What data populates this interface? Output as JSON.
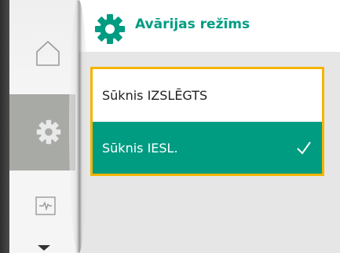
{
  "header": {
    "title": "Avārijas režīms",
    "icon": "gear-icon"
  },
  "sidebar": {
    "items": [
      {
        "name": "home",
        "icon": "home-icon"
      },
      {
        "name": "settings",
        "icon": "gear-icon",
        "selected": true
      },
      {
        "name": "info",
        "icon": "pulse-icon"
      }
    ],
    "more_icon": "chevron-down-icon"
  },
  "options": [
    {
      "label": "Sūknis IZSLĒGTS",
      "selected": false
    },
    {
      "label": "Sūknis IESL.",
      "selected": true
    }
  ],
  "colors": {
    "accent": "#009c82",
    "focus": "#f5b400",
    "rail_selected": "#a8aaa6"
  }
}
